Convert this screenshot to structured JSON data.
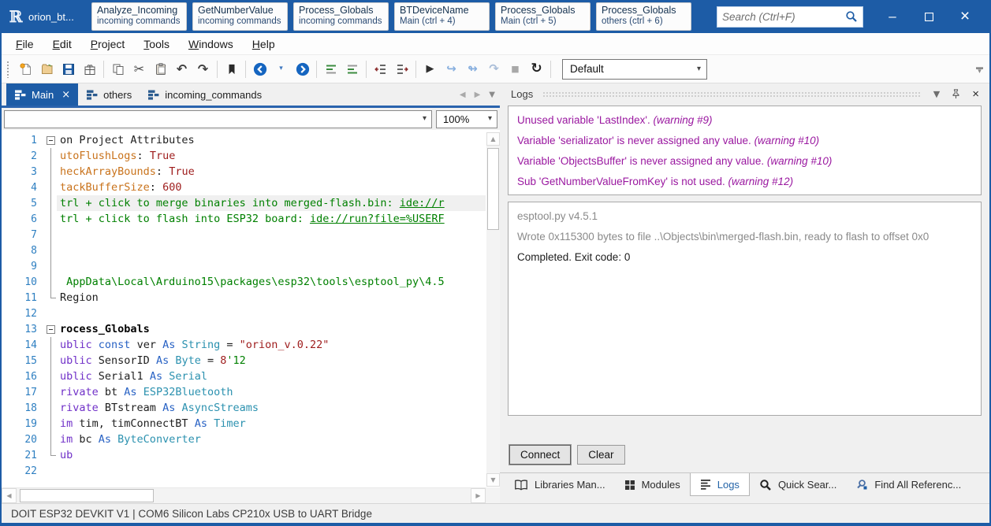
{
  "window": {
    "title": "orion_bt...",
    "controls": {
      "minimize": "–",
      "maximize": "maximize",
      "close": "×"
    }
  },
  "colors": {
    "accent": "#1d5ca6",
    "warning_text": "#9a18a0",
    "comment_green": "#008000",
    "keyword_purple": "#7030c8",
    "keyword_blue": "#2862c4",
    "type_teal": "#2b91af",
    "value_red": "#9e1c1c",
    "attribute_orange": "#c9731c",
    "line_number_blue": "#2e7fc1"
  },
  "search": {
    "placeholder": "Search (Ctrl+F)"
  },
  "title_tabs": [
    {
      "title": "Analyze_Incoming",
      "subtitle": "incoming commands"
    },
    {
      "title": "GetNumberValue",
      "subtitle": "incoming commands"
    },
    {
      "title": "Process_Globals",
      "subtitle": "incoming commands"
    },
    {
      "title": "BTDeviceName",
      "subtitle": "Main  (ctrl + 4)"
    },
    {
      "title": "Process_Globals",
      "subtitle": "Main  (ctrl + 5)"
    },
    {
      "title": "Process_Globals",
      "subtitle": "others  (ctrl + 6)"
    }
  ],
  "menu": [
    "File",
    "Edit",
    "Project",
    "Tools",
    "Windows",
    "Help"
  ],
  "toolbar": {
    "profile": "Default",
    "groups": [
      [
        "new-file-icon",
        "open-file-icon",
        "save-icon",
        "save-all-icon"
      ],
      [
        "copy-icon",
        "cut-icon",
        "paste-icon",
        "undo-icon",
        "redo-icon"
      ],
      [
        "bookmark-icon"
      ],
      [
        "nav-back-icon",
        "nav-back-menu-icon",
        "nav-forward-icon"
      ],
      [
        "comment-icon",
        "uncomment-icon"
      ],
      [
        "outdent-icon",
        "indent-icon"
      ],
      [
        "run-icon",
        "step-into-icon",
        "step-over-icon",
        "step-out-icon",
        "stop-icon",
        "rebuild-icon"
      ]
    ]
  },
  "editor": {
    "tabs": [
      {
        "label": "Main",
        "active": true,
        "closable": true
      },
      {
        "label": "others",
        "active": false,
        "closable": false
      },
      {
        "label": "incoming_commands",
        "active": false,
        "closable": false
      }
    ],
    "zoom": "100%",
    "module_combo_value": "",
    "code_lines": [
      {
        "n": 1,
        "fold": "open",
        "segs": [
          [
            "plain",
            "on Project Attributes"
          ]
        ]
      },
      {
        "n": 2,
        "fold": "rail",
        "segs": [
          [
            "attr",
            "utoFlushLogs"
          ],
          [
            "plain",
            ": "
          ],
          [
            "num",
            "True"
          ]
        ]
      },
      {
        "n": 3,
        "fold": "rail",
        "segs": [
          [
            "attr",
            "heckArrayBounds"
          ],
          [
            "plain",
            ": "
          ],
          [
            "num",
            "True"
          ]
        ]
      },
      {
        "n": 4,
        "fold": "rail",
        "segs": [
          [
            "attr",
            "tackBufferSize"
          ],
          [
            "plain",
            ": "
          ],
          [
            "num",
            "600"
          ]
        ]
      },
      {
        "n": 5,
        "fold": "rail",
        "hl": true,
        "segs": [
          [
            "cm",
            "trl + click to merge binaries into merged-flash.bin: "
          ],
          [
            "link",
            "ide://r"
          ]
        ]
      },
      {
        "n": 6,
        "fold": "rail",
        "segs": [
          [
            "cm",
            "trl + click to flash into ESP32 board: "
          ],
          [
            "link",
            "ide://run?file=%USERF"
          ]
        ]
      },
      {
        "n": 7,
        "fold": "rail",
        "segs": []
      },
      {
        "n": 8,
        "fold": "rail",
        "segs": []
      },
      {
        "n": 9,
        "fold": "rail",
        "segs": []
      },
      {
        "n": 10,
        "fold": "rail",
        "segs": [
          [
            "cm",
            " AppData\\Local\\Arduino15\\packages\\esp32\\tools\\esptool_py\\4.5"
          ]
        ]
      },
      {
        "n": 11,
        "fold": "end",
        "segs": [
          [
            "plain",
            "Region"
          ]
        ]
      },
      {
        "n": 12,
        "fold": "",
        "segs": []
      },
      {
        "n": 13,
        "fold": "open",
        "segs": [
          [
            "bold",
            "rocess_Globals"
          ]
        ]
      },
      {
        "n": 14,
        "fold": "rail",
        "segs": [
          [
            "kw",
            "ublic "
          ],
          [
            "kw2",
            "const "
          ],
          [
            "plain",
            "ver "
          ],
          [
            "kw2",
            "As "
          ],
          [
            "type",
            "String"
          ],
          [
            "plain",
            " = "
          ],
          [
            "str",
            "\"orion_v.0.22\""
          ]
        ]
      },
      {
        "n": 15,
        "fold": "rail",
        "segs": [
          [
            "kw",
            "ublic "
          ],
          [
            "plain",
            "SensorID "
          ],
          [
            "kw2",
            "As "
          ],
          [
            "type",
            "Byte"
          ],
          [
            "plain",
            " = "
          ],
          [
            "num",
            "8"
          ],
          [
            "cm",
            "'12"
          ]
        ]
      },
      {
        "n": 16,
        "fold": "rail",
        "segs": [
          [
            "kw",
            "ublic "
          ],
          [
            "plain",
            "Serial1 "
          ],
          [
            "kw2",
            "As "
          ],
          [
            "type",
            "Serial"
          ]
        ]
      },
      {
        "n": 17,
        "fold": "rail",
        "segs": [
          [
            "kw",
            "rivate "
          ],
          [
            "plain",
            "bt "
          ],
          [
            "kw2",
            "As "
          ],
          [
            "type",
            "ESP32Bluetooth"
          ]
        ]
      },
      {
        "n": 18,
        "fold": "rail",
        "segs": [
          [
            "kw",
            "rivate "
          ],
          [
            "plain",
            "BTstream "
          ],
          [
            "kw2",
            "As "
          ],
          [
            "type",
            "AsyncStreams"
          ]
        ]
      },
      {
        "n": 19,
        "fold": "rail",
        "segs": [
          [
            "kw",
            "im "
          ],
          [
            "plain",
            "tim, timConnectBT "
          ],
          [
            "kw2",
            "As "
          ],
          [
            "type",
            "Timer"
          ]
        ]
      },
      {
        "n": 20,
        "fold": "rail",
        "segs": [
          [
            "kw",
            "im "
          ],
          [
            "plain",
            "bc "
          ],
          [
            "kw2",
            "As "
          ],
          [
            "type",
            "ByteConverter"
          ]
        ]
      },
      {
        "n": 21,
        "fold": "end",
        "segs": [
          [
            "kw",
            "ub"
          ]
        ]
      },
      {
        "n": 22,
        "fold": "",
        "segs": []
      }
    ]
  },
  "logs_panel": {
    "title": "Logs",
    "warnings": [
      {
        "text": "Unused variable 'LastIndex'. ",
        "tag": "(warning #9)"
      },
      {
        "text": "Variable 'serializator' is never assigned any value. ",
        "tag": "(warning #10)"
      },
      {
        "text": "Variable 'ObjectsBuffer' is never assigned any value. ",
        "tag": "(warning #10)"
      },
      {
        "text": "Sub 'GetNumberValueFromKey' is not used. ",
        "tag": "(warning #12)"
      }
    ],
    "output": [
      {
        "text": "esptool.py v4.5.1",
        "muted": true
      },
      {
        "text": "Wrote 0x115300 bytes to file ..\\Objects\\bin\\merged-flash.bin, ready to flash to offset 0x0",
        "muted": true
      },
      {
        "text": "Completed. Exit code: 0",
        "muted": false
      }
    ],
    "buttons": [
      "Connect",
      "Clear"
    ],
    "tabs": [
      {
        "label": "Libraries Man...",
        "icon": "book-icon",
        "active": false
      },
      {
        "label": "Modules",
        "icon": "modules-icon",
        "active": false
      },
      {
        "label": "Logs",
        "icon": "logs-icon",
        "active": true
      },
      {
        "label": "Quick Sear...",
        "icon": "search-bold-icon",
        "active": false
      },
      {
        "label": "Find All Referenc...",
        "icon": "find-ref-icon",
        "active": false
      }
    ]
  },
  "status_bar": {
    "text": "DOIT ESP32 DEVKIT V1 | COM6 Silicon Labs CP210x USB to UART Bridge"
  }
}
